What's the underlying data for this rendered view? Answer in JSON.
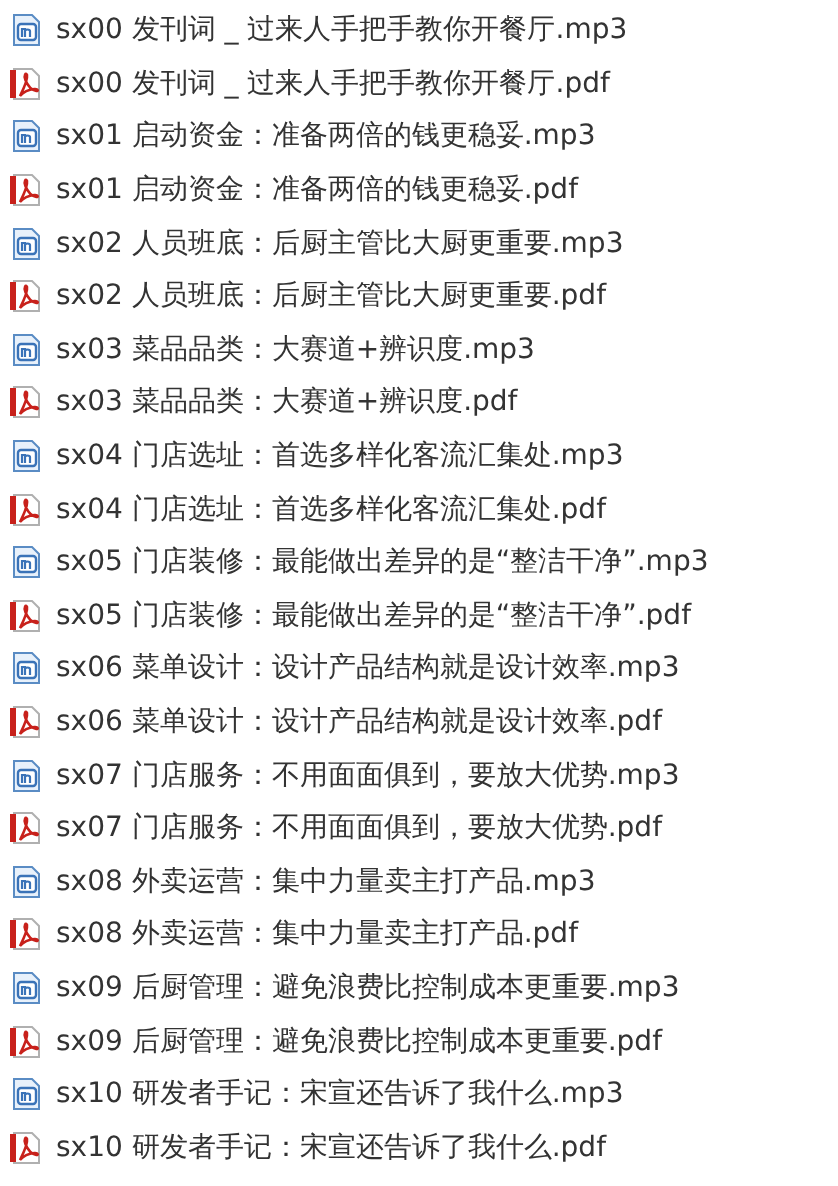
{
  "files": [
    {
      "kind": "audio",
      "name": "sx00 发刊词 _ 过来人手把手教你开餐厅.mp3"
    },
    {
      "kind": "pdf",
      "name": "sx00 发刊词 _ 过来人手把手教你开餐厅.pdf"
    },
    {
      "kind": "audio",
      "name": "sx01 启动资金：准备两倍的钱更稳妥.mp3"
    },
    {
      "kind": "pdf",
      "name": "sx01 启动资金：准备两倍的钱更稳妥.pdf"
    },
    {
      "kind": "audio",
      "name": "sx02 人员班底：后厨主管比大厨更重要.mp3"
    },
    {
      "kind": "pdf",
      "name": "sx02 人员班底：后厨主管比大厨更重要.pdf"
    },
    {
      "kind": "audio",
      "name": "sx03 菜品品类：大赛道+辨识度.mp3"
    },
    {
      "kind": "pdf",
      "name": "sx03 菜品品类：大赛道+辨识度.pdf"
    },
    {
      "kind": "audio",
      "name": "sx04 门店选址：首选多样化客流汇集处.mp3"
    },
    {
      "kind": "pdf",
      "name": "sx04 门店选址：首选多样化客流汇集处.pdf"
    },
    {
      "kind": "audio",
      "name": "sx05 门店装修：最能做出差异的是“整洁干净”.mp3"
    },
    {
      "kind": "pdf",
      "name": "sx05 门店装修：最能做出差异的是“整洁干净”.pdf"
    },
    {
      "kind": "audio",
      "name": "sx06 菜单设计：设计产品结构就是设计效率.mp3"
    },
    {
      "kind": "pdf",
      "name": "sx06 菜单设计：设计产品结构就是设计效率.pdf"
    },
    {
      "kind": "audio",
      "name": "sx07 门店服务：不用面面俱到，要放大优势.mp3"
    },
    {
      "kind": "pdf",
      "name": "sx07 门店服务：不用面面俱到，要放大优势.pdf"
    },
    {
      "kind": "audio",
      "name": "sx08 外卖运营：集中力量卖主打产品.mp3"
    },
    {
      "kind": "pdf",
      "name": "sx08 外卖运营：集中力量卖主打产品.pdf"
    },
    {
      "kind": "audio",
      "name": "sx09 后厨管理：避免浪费比控制成本更重要.mp3"
    },
    {
      "kind": "pdf",
      "name": "sx09 后厨管理：避免浪费比控制成本更重要.pdf"
    },
    {
      "kind": "audio",
      "name": "sx10 研发者手记：宋宣还告诉了我什么.mp3"
    },
    {
      "kind": "pdf",
      "name": "sx10 研发者手记：宋宣还告诉了我什么.pdf"
    }
  ]
}
